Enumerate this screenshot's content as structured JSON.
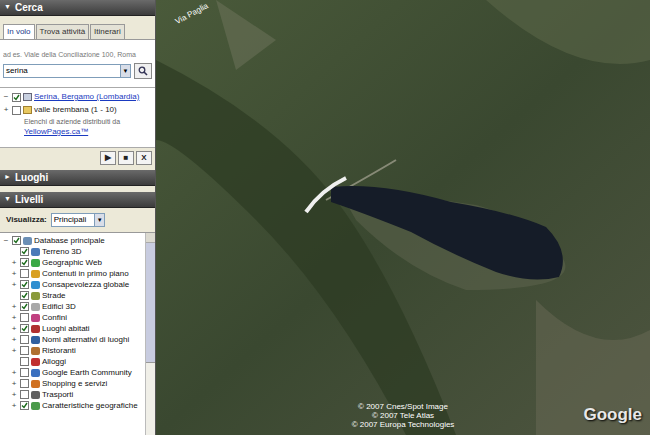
{
  "search_panel": {
    "title": "Cerca",
    "arrow": "▼",
    "expanded": true,
    "tabs": [
      {
        "label": "In volo",
        "selected": true
      },
      {
        "label": "Trova attività",
        "selected": false
      },
      {
        "label": "Itinerari",
        "selected": false
      }
    ],
    "hint": "ad es. Viale della Conciliazione 100, Roma",
    "query": "serina",
    "dropdown_arrow": "▼",
    "results": [
      {
        "label": "Serina, Bergamo (Lombardia)",
        "checked": true,
        "link": true,
        "expander": "−"
      },
      {
        "label": "valle brembana (1 - 10)",
        "checked": false,
        "link": false,
        "expander": "+"
      }
    ],
    "sponsor": {
      "text": "Elenchi di aziende distribuiti da",
      "link": "YellowPages.ca™"
    },
    "controls": [
      "▶",
      "■",
      "X"
    ]
  },
  "places_panel": {
    "title": "Luoghi",
    "arrow": "►",
    "expanded": false
  },
  "layers_panel": {
    "title": "Livelli",
    "arrow": "▼",
    "expanded": true,
    "view_label": "Visualizza:",
    "view_value": "Principali",
    "view_arrow": "▼",
    "items": [
      {
        "label": "Database principale",
        "checked": true,
        "expander": "−",
        "level": 0
      },
      {
        "label": "Terreno 3D",
        "checked": true,
        "expander": "",
        "level": 1
      },
      {
        "label": "Geographic Web",
        "checked": true,
        "expander": "+",
        "level": 1
      },
      {
        "label": "Contenuti in primo piano",
        "checked": false,
        "expander": "+",
        "level": 1
      },
      {
        "label": "Consapevolezza globale",
        "checked": true,
        "expander": "+",
        "level": 1
      },
      {
        "label": "Strade",
        "checked": true,
        "expander": "",
        "level": 1
      },
      {
        "label": "Edifici 3D",
        "checked": true,
        "expander": "+",
        "level": 1
      },
      {
        "label": "Confini",
        "checked": false,
        "expander": "+",
        "level": 1
      },
      {
        "label": "Luoghi abitati",
        "checked": true,
        "expander": "+",
        "level": 1
      },
      {
        "label": "Nomi alternativi di luoghi",
        "checked": false,
        "expander": "+",
        "level": 1
      },
      {
        "label": "Ristoranti",
        "checked": false,
        "expander": "+",
        "level": 1
      },
      {
        "label": "Alloggi",
        "checked": false,
        "expander": "",
        "level": 1
      },
      {
        "label": "Google Earth Community",
        "checked": false,
        "expander": "+",
        "level": 1
      },
      {
        "label": "Shopping e servizi",
        "checked": false,
        "expander": "+",
        "level": 1
      },
      {
        "label": "Trasporti",
        "checked": false,
        "expander": "+",
        "level": 1
      },
      {
        "label": "Caratteristiche geografiche",
        "checked": true,
        "expander": "+",
        "level": 1
      }
    ]
  },
  "map": {
    "road_label": "Via Paglia",
    "attributions": [
      "© 2007 Cnes/Spot Image",
      "© 2007 Tele Atlas",
      "© 2007 Europa Technologies"
    ],
    "logo": "Google"
  }
}
